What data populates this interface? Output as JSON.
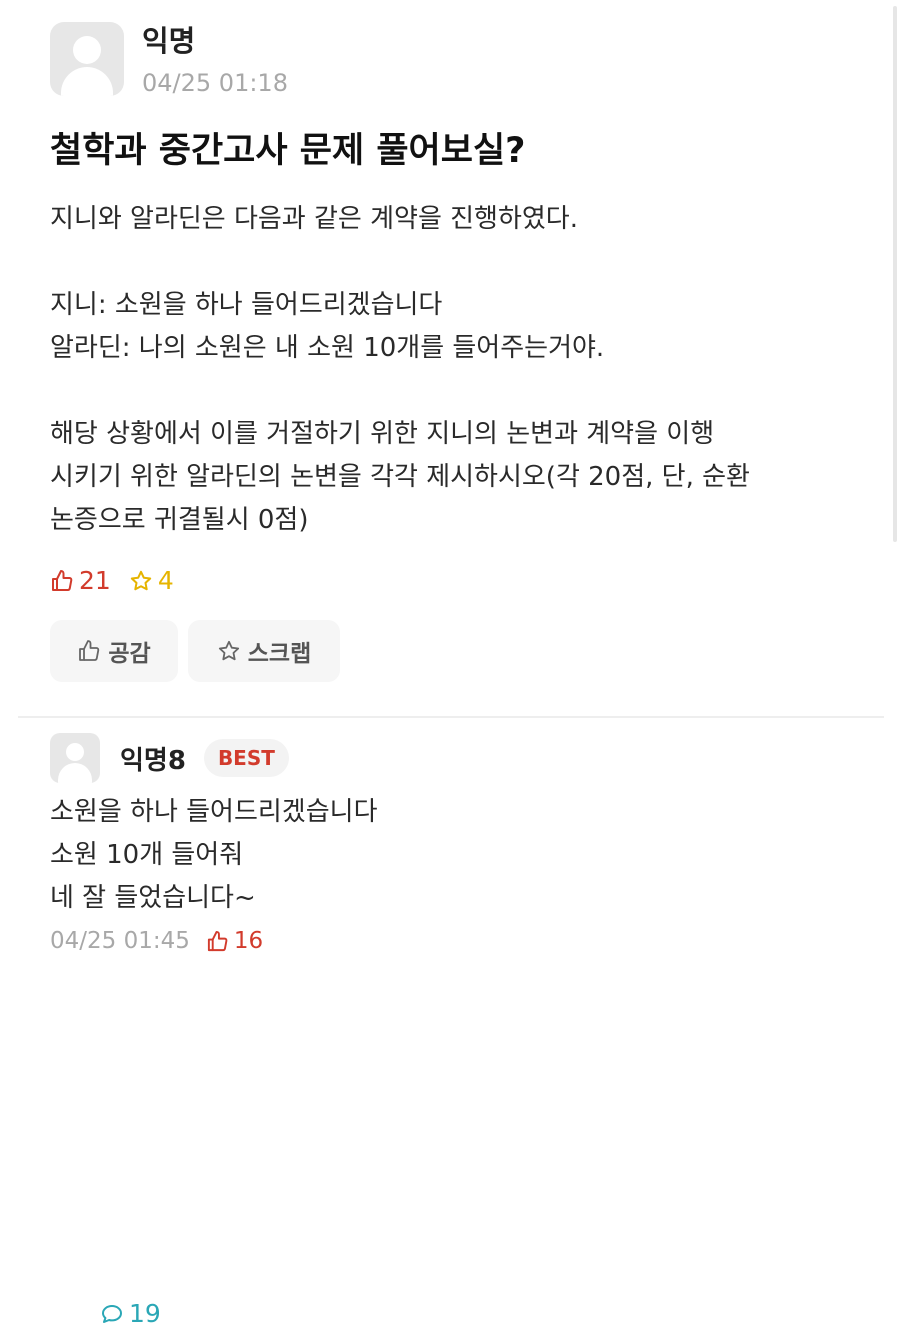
{
  "post": {
    "author": "익명",
    "time": "04/25 01:18",
    "title": "철학과 중간고사 문제 풀어보실?",
    "body": {
      "line1": "지니와 알라딘은 다음과 같은 계약을 진행하였다.",
      "line2": "지니: 소원을 하나 들어드리겠습니다",
      "line3": "알라딘: 나의 소원은 내 소원 10개를 들어주는거야.",
      "line4": "해당 상황에서 이를 거절하기 위한 지니의 논변과 계약을 이행",
      "line5": "시키기 위한 알라딘의 논변을 각각 제시하시오(각 20점, 단, 순환",
      "line6": "논증으로 귀결될시 0점)"
    },
    "stats": {
      "likes": "21",
      "comments": "19",
      "scraps": "4"
    },
    "actions": {
      "empathy_label": "공감",
      "scrap_label": "스크랩"
    }
  },
  "comment": {
    "author": "익명8",
    "badge": "BEST",
    "lines": [
      "소원을 하나 들어드리겠습니다",
      "소원 10개 들어줘",
      "네 잘 들었습니다~"
    ],
    "time": "04/25 01:45",
    "likes": "16"
  },
  "colors": {
    "like": "#d23b2c",
    "comment": "#2aa7b6",
    "scrap": "#e6b400",
    "muted": "#a8a8a8"
  },
  "icons": {
    "like": "thumbs-up-icon",
    "comment": "speech-bubble-icon",
    "scrap": "star-icon"
  }
}
